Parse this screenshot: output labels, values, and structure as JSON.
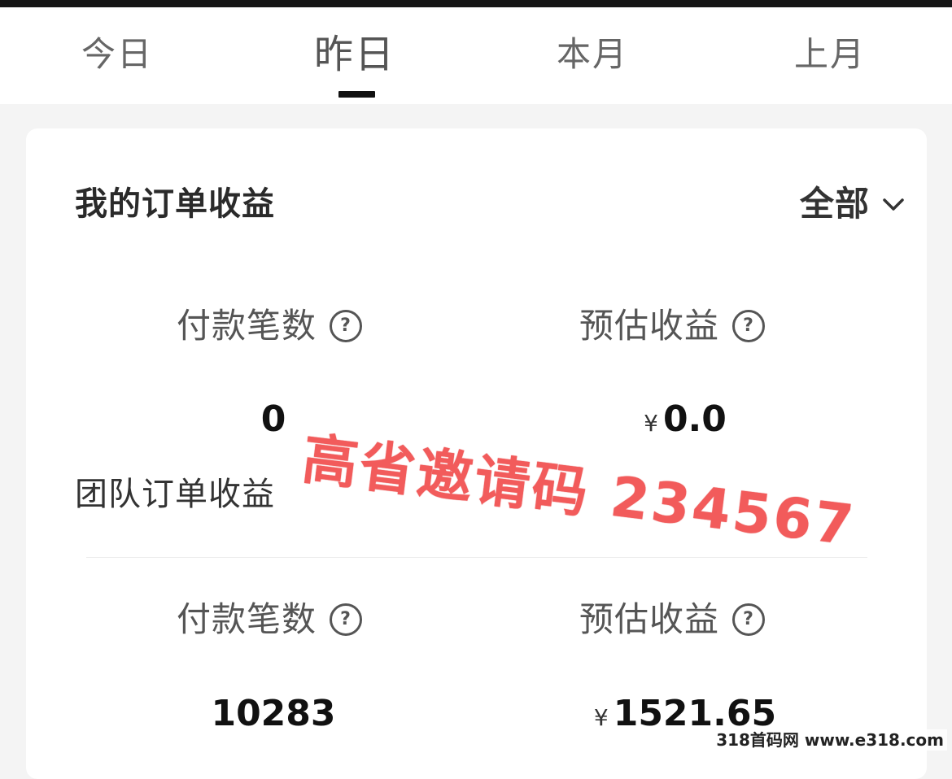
{
  "tabs": [
    {
      "label": "今日"
    },
    {
      "label": "昨日"
    },
    {
      "label": "本月"
    },
    {
      "label": "上月"
    }
  ],
  "my_orders": {
    "title": "我的订单收益",
    "filter": "全部",
    "paid_count_label": "付款笔数",
    "paid_count_value": "0",
    "estimated_income_label": "预估收益",
    "currency": "¥",
    "estimated_income_value": "0.0"
  },
  "team_orders": {
    "title": "团队订单收益",
    "paid_count_label": "付款笔数",
    "paid_count_value": "10283",
    "estimated_income_label": "预估收益",
    "currency": "¥",
    "estimated_income_value": "1521.65"
  },
  "overlay": {
    "invite_text": "高省邀请码 234567",
    "site_text": "318首码网 www.e318.com"
  },
  "icons": {
    "help": "question-circle-icon",
    "dropdown": "chevron-down-icon"
  },
  "colors": {
    "watermark": "#f25b5b",
    "tab_indicator": "#111111"
  }
}
